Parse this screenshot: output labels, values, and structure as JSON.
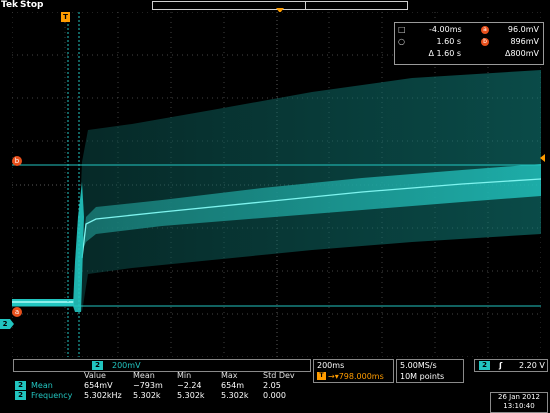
{
  "header": {
    "brand": "Tek",
    "run_state": "Stop"
  },
  "cursor_readout": {
    "t1": "-4.00ms",
    "a_level": "96.0mV",
    "t2": "1.60 s",
    "b_level": "896mV",
    "dt": "Δ 1.60 s",
    "dv": "Δ800mV",
    "a_icon": "a",
    "b_icon": "b"
  },
  "markers": {
    "trigger": "T",
    "cursor_a": "a",
    "cursor_b": "b",
    "channel": "2"
  },
  "channel2": {
    "badge": "2",
    "vdiv": "200mV",
    "color": "#22c5c0"
  },
  "measurements": {
    "headers": [
      "Value",
      "Mean",
      "Min",
      "Max",
      "Std Dev"
    ],
    "rows": [
      {
        "badge": "2",
        "name": "Mean",
        "values": [
          "654mV",
          "−793m",
          "−2.24",
          "654m",
          "2.05"
        ]
      },
      {
        "badge": "2",
        "name": "Frequency",
        "values": [
          "5.302kHz",
          "5.302k",
          "5.302k",
          "5.302k",
          "0.000"
        ]
      }
    ]
  },
  "timebase": {
    "scale": "200ms",
    "position_icon": "T",
    "position": "→▾798.000ms"
  },
  "acquisition": {
    "rate": "5.00MS/s",
    "points": "10M points"
  },
  "trigger": {
    "badge": "2",
    "slope": "ʃ",
    "level": "2.20 V"
  },
  "datetime": {
    "date": "26 Jan 2012",
    "time": "13:10:40"
  },
  "colors": {
    "trace": "#22c5c0",
    "trigger": "#ff9c00",
    "cursor": "#e8501c",
    "grid": "#5a5a5a"
  }
}
